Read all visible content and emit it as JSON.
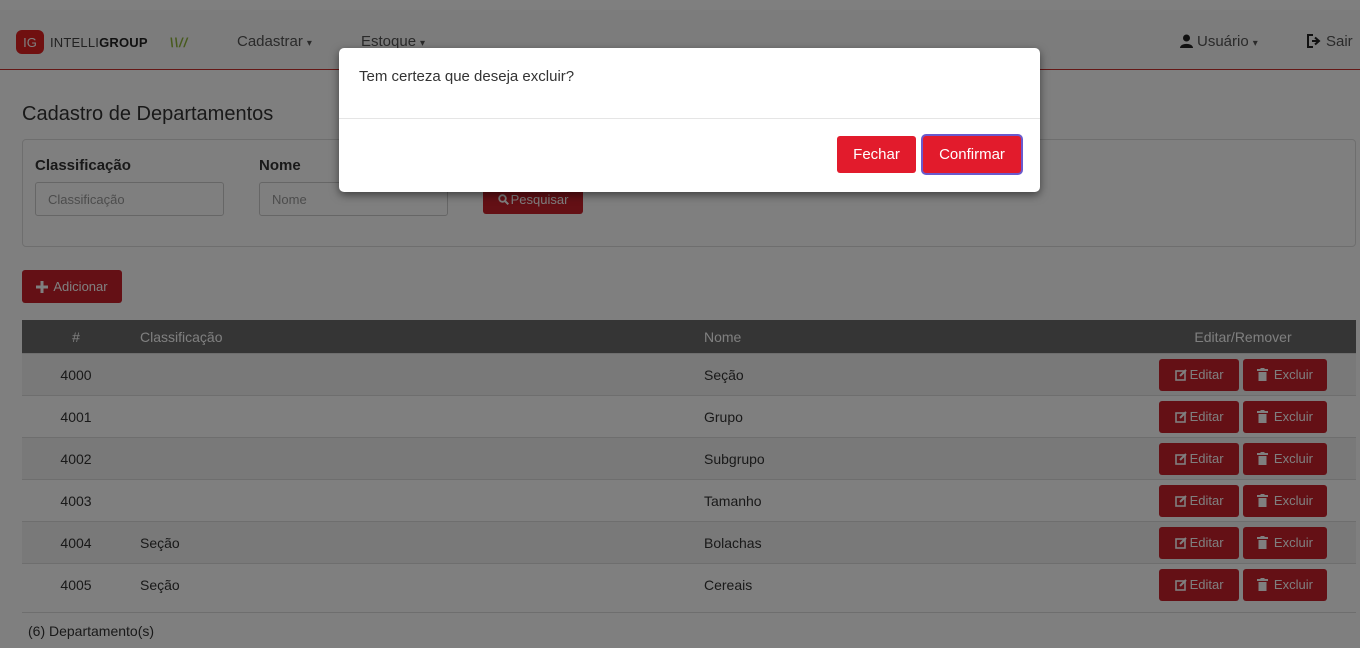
{
  "navbar": {
    "logo_badge": "IG",
    "logo_light": "INTELLI",
    "logo_bold": "GROUP",
    "logo_mark": "\\\\//",
    "menu": [
      {
        "label": "Cadastrar",
        "caret": "▾"
      },
      {
        "label": "Estoque",
        "caret": "▾"
      }
    ],
    "user_label": "Usuário",
    "user_caret": "▾",
    "logout_label": "Sair"
  },
  "page": {
    "title": "Cadastro de Departamentos"
  },
  "filters": {
    "classificacao_label": "Classificação",
    "classificacao_placeholder": "Classificação",
    "nome_label": "Nome",
    "nome_placeholder": "Nome",
    "search_label": "Pesquisar"
  },
  "add_button_label": "Adicionar",
  "table": {
    "headers": [
      "#",
      "Classificação",
      "Nome",
      "Editar/Remover"
    ],
    "edit_label": "Editar",
    "delete_label": "Excluir",
    "rows": [
      {
        "id": "4000",
        "classificacao": "",
        "nome": "Seção"
      },
      {
        "id": "4001",
        "classificacao": "",
        "nome": "Grupo"
      },
      {
        "id": "4002",
        "classificacao": "",
        "nome": "Subgrupo"
      },
      {
        "id": "4003",
        "classificacao": "",
        "nome": "Tamanho"
      },
      {
        "id": "4004",
        "classificacao": "Seção",
        "nome": "Bolachas"
      },
      {
        "id": "4005",
        "classificacao": "Seção",
        "nome": "Cereais"
      }
    ]
  },
  "footer": {
    "count_text": "(6) Departamento(s)"
  },
  "modal": {
    "message": "Tem certeza que deseja excluir?",
    "close_label": "Fechar",
    "confirm_label": "Confirmar"
  },
  "colors": {
    "primary_red": "#c9202a",
    "modal_red": "#e21b2c",
    "table_header": "#6b6b6b"
  }
}
